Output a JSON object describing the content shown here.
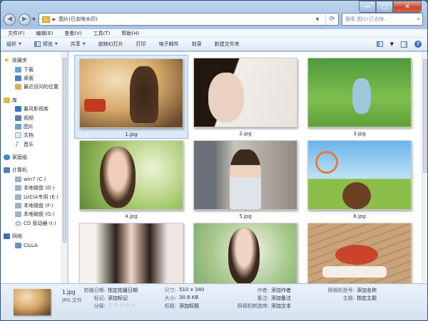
{
  "window": {
    "minimize_glyph": "—",
    "maximize_glyph": "□",
    "close_glyph": "✕"
  },
  "address": {
    "path": "图片(已去除水印)",
    "placeholder": "搜索 图片(已去除..."
  },
  "menu": [
    "文件(F)",
    "编辑(E)",
    "查看(V)",
    "工具(T)",
    "帮助(H)"
  ],
  "toolbar": {
    "organize": "组织",
    "preview": "预览",
    "share": "共享",
    "slideshow": "放映幻灯片",
    "print": "打印",
    "email": "电子邮件",
    "burn": "刻录",
    "new_folder": "新建文件夹",
    "help_glyph": "?"
  },
  "nav": {
    "favorites": "收藏夹",
    "downloads": "下载",
    "desktop": "桌面",
    "recent": "最近访问的位置",
    "libraries": "库",
    "video_lib": "暴风影视库",
    "videos": "视频",
    "pictures": "图片",
    "documents": "文档",
    "music": "音乐",
    "homegroup": "家庭组",
    "computer": "计算机",
    "drive_c": "win7 (C:)",
    "drive_d": "本地磁盘 (D:)",
    "drive_e": "LUCIA专用 (E:)",
    "drive_f": "本地磁盘 (F:)",
    "drive_g": "本地磁盘 (G:)",
    "drive_cd": "CD 驱动器 (I:)",
    "network": "网络",
    "cilla": "CILLA"
  },
  "files": [
    "1.jpg",
    "2.jpg",
    "3.jpg",
    "4.jpg",
    "5.jpg",
    "6.jpg",
    "",
    "",
    ""
  ],
  "details": {
    "name": "1.jpg",
    "type": "JPG 文件",
    "date_label": "拍摄日期:",
    "date_value": "指定拍摄日期",
    "tags_label": "标记:",
    "tags_value": "添加标记",
    "rating_label": "分级:",
    "rating_value": "☆☆☆☆☆",
    "dims_label": "尺寸:",
    "dims_value": "510 x 340",
    "size_label": "大小:",
    "size_value": "30.6 KB",
    "title_label": "标题:",
    "title_value": "添加标题",
    "author_label": "作者:",
    "author_value": "添加作者",
    "comment_label": "备注:",
    "comment_value": "添加备注",
    "maker_label": "照相机制造商:",
    "maker_value": "添加文本",
    "model_label": "照相机型号:",
    "model_value": "添加名称",
    "subject_label": "主题:",
    "subject_value": "指定主题"
  },
  "colors": {
    "selection": "#dbeaf9",
    "accent": "#3f6fb6"
  }
}
